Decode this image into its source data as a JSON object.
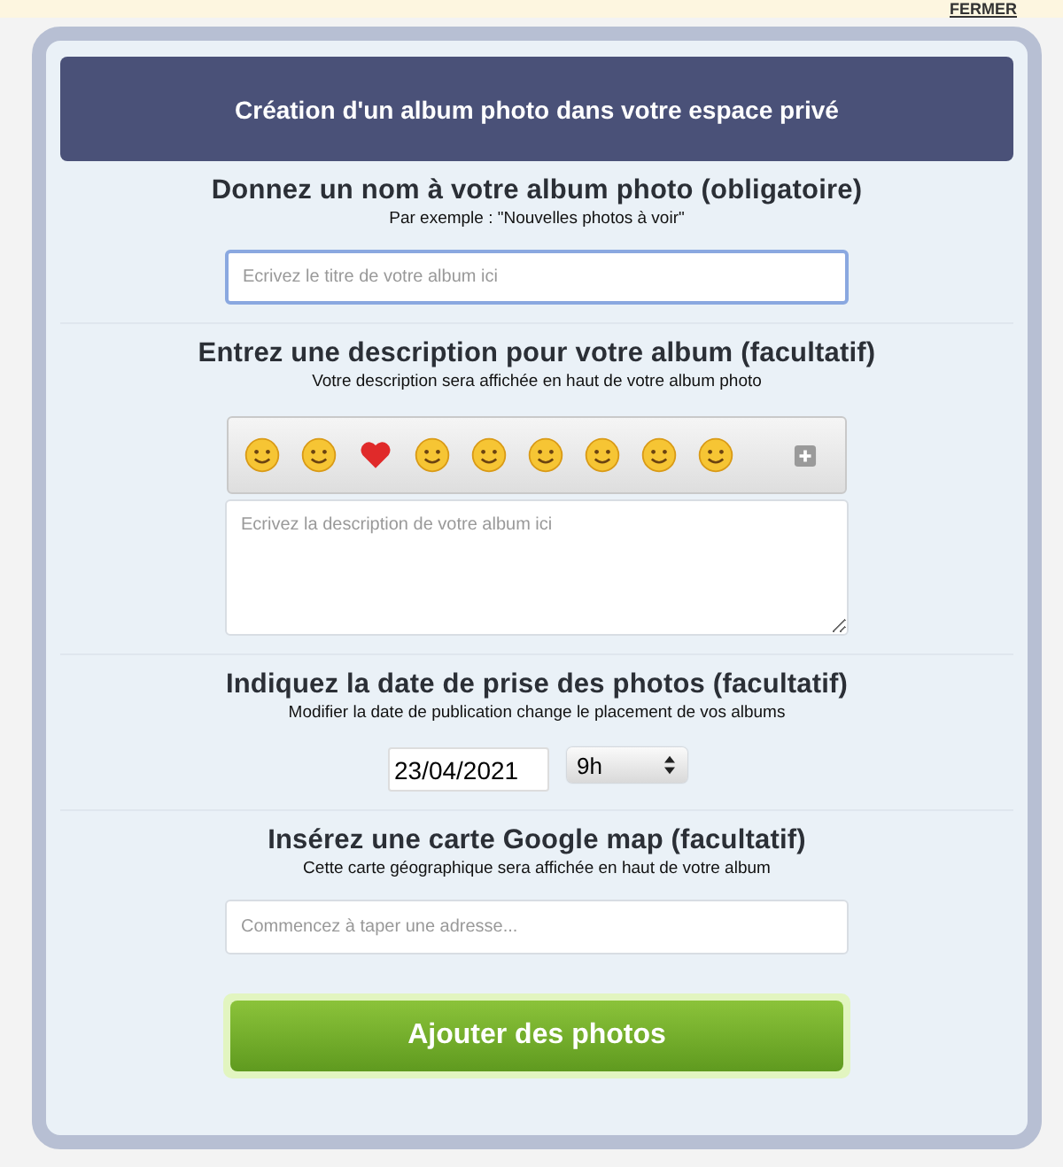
{
  "top_bar": {
    "close_link": "FERMER"
  },
  "dialog": {
    "title": "Création d'un album photo dans votre espace privé",
    "name_section": {
      "heading": "Donnez un nom à votre album photo (obligatoire)",
      "hint": "Par exemple : \"Nouvelles photos à voir\"",
      "field": {
        "placeholder": "Ecrivez le titre de votre album ici",
        "focused": true
      }
    },
    "description_section": {
      "heading": "Entrez une description pour votre album (facultatif)",
      "hint": "Votre description sera affichée en haut de votre album photo",
      "emojis": [
        {
          "kind": "smiley"
        },
        {
          "kind": "smiley"
        },
        {
          "kind": "heart"
        },
        {
          "kind": "smiley"
        },
        {
          "kind": "smiley"
        },
        {
          "kind": "smiley"
        },
        {
          "kind": "smiley"
        },
        {
          "kind": "smiley"
        },
        {
          "kind": "smiley"
        }
      ],
      "field": {
        "placeholder": "Ecrivez la description de votre album ici"
      }
    },
    "date_section": {
      "heading": "Indiquez la date de prise des photos (facultatif)",
      "hint": "Modifier la date de publication change le placement de vos albums",
      "date": "23/04/2021",
      "hour": "9h"
    },
    "map_section": {
      "heading": "Insérez une carte Google map (facultatif)",
      "hint": "Cette carte géographique sera affichée en haut de votre album",
      "field": {
        "placeholder": "Commencez à taper une adresse..."
      }
    },
    "submit_button": "Ajouter des photos"
  }
}
